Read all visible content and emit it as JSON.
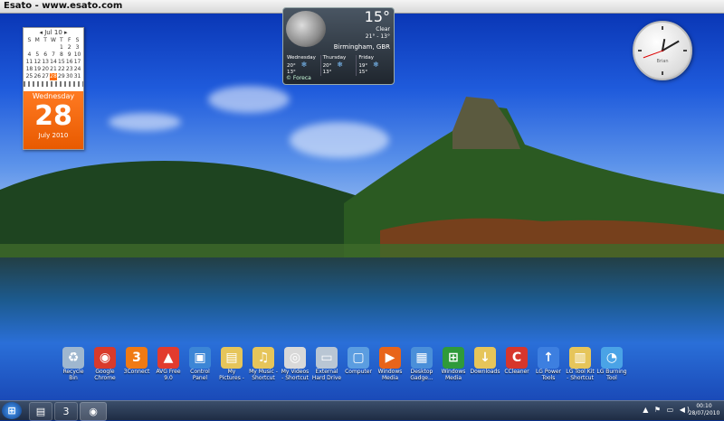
{
  "title_bar": {
    "text": "Esato - www.esato.com"
  },
  "calendar_gadget": {
    "month": "Jul 10",
    "weekdays": [
      "S",
      "M",
      "T",
      "W",
      "T",
      "F",
      "S"
    ],
    "weeks": [
      [
        "",
        "",
        "",
        "",
        "1",
        "2",
        "3"
      ],
      [
        "4",
        "5",
        "6",
        "7",
        "8",
        "9",
        "10"
      ],
      [
        "11",
        "12",
        "13",
        "14",
        "15",
        "16",
        "17"
      ],
      [
        "18",
        "19",
        "20",
        "21",
        "22",
        "23",
        "24"
      ],
      [
        "25",
        "26",
        "27",
        "28",
        "29",
        "30",
        "31"
      ]
    ],
    "today": "28",
    "day_name": "Wednesday",
    "day_number": "28",
    "month_year": "July 2010"
  },
  "weather_gadget": {
    "temperature": "15°",
    "condition": "Clear",
    "range": "21° - 13°",
    "location": "Birmingham, GBR",
    "forecast": [
      {
        "day": "Wednesday",
        "high": "20°",
        "low": "13°"
      },
      {
        "day": "Thursday",
        "high": "20°",
        "low": "13°"
      },
      {
        "day": "Friday",
        "high": "19°",
        "low": "15°"
      }
    ],
    "credit": "© Foreca"
  },
  "clock_gadget": {
    "label": "Brian"
  },
  "desktop_icons": [
    {
      "label": "Recycle Bin",
      "icon": "recycle-bin-icon",
      "color": "#9fb7cf",
      "glyph": "♻"
    },
    {
      "label": "Google Chrome",
      "icon": "chrome-icon",
      "color": "#d93a2b",
      "glyph": "◉"
    },
    {
      "label": "3Connect",
      "icon": "3connect-icon",
      "color": "#f07a14",
      "glyph": "3"
    },
    {
      "label": "AVG Free 9.0",
      "icon": "avg-icon",
      "color": "#e23b2e",
      "glyph": "▲"
    },
    {
      "label": "Control Panel",
      "icon": "control-panel-icon",
      "color": "#3c86d6",
      "glyph": "▣"
    },
    {
      "label": "My Pictures - Shortcut",
      "icon": "folder-pictures-icon",
      "color": "#e6c55a",
      "glyph": "▤"
    },
    {
      "label": "My Music - Shortcut",
      "icon": "folder-music-icon",
      "color": "#e6c55a",
      "glyph": "♫"
    },
    {
      "label": "My Videos - Shortcut",
      "icon": "folder-videos-icon",
      "color": "#d9d9d9",
      "glyph": "◎"
    },
    {
      "label": "External Hard Drive (F) - S...",
      "icon": "hard-drive-icon",
      "color": "#b9c6d4",
      "glyph": "▭"
    },
    {
      "label": "Computer",
      "icon": "computer-icon",
      "color": "#5b9de0",
      "glyph": "▢"
    },
    {
      "label": "Windows Media Player",
      "icon": "media-player-icon",
      "color": "#e8641a",
      "glyph": "▶"
    },
    {
      "label": "Desktop Gadge...",
      "icon": "gadgets-icon",
      "color": "#4a8fd9",
      "glyph": "▦"
    },
    {
      "label": "Windows Media Center",
      "icon": "media-center-icon",
      "color": "#2f9a3a",
      "glyph": "⊞"
    },
    {
      "label": "Downloads",
      "icon": "folder-downloads-icon",
      "color": "#e6c55a",
      "glyph": "↓"
    },
    {
      "label": "CCleaner",
      "icon": "ccleaner-icon",
      "color": "#d7362c",
      "glyph": "C"
    },
    {
      "label": "LG Power Tools",
      "icon": "lg-power-tools-icon",
      "color": "#3d7fe0",
      "glyph": "↑"
    },
    {
      "label": "LG Tool Kit - Shortcut",
      "icon": "lg-toolkit-icon",
      "color": "#e6c55a",
      "glyph": "▥"
    },
    {
      "label": "LG Burning Tool",
      "icon": "lg-burning-tool-icon",
      "color": "#4aa3e6",
      "glyph": "◔"
    }
  ],
  "taskbar": {
    "start_glyph": "⊞",
    "pinned": [
      {
        "name": "windows-explorer-task-button",
        "glyph": "▤"
      },
      {
        "name": "3connect-task-button",
        "glyph": "3"
      },
      {
        "name": "chrome-task-button",
        "glyph": "◉"
      }
    ],
    "tray_glyphs": "▲ ⚑ ▭ ◀)",
    "time": "00:10",
    "date": "28/07/2010"
  }
}
